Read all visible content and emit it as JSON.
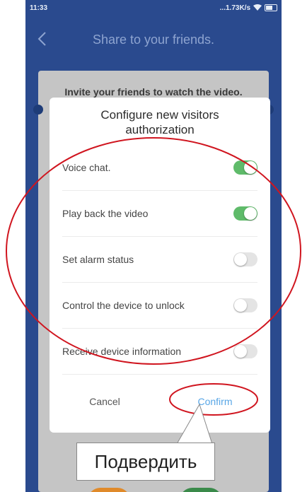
{
  "status_bar": {
    "time": "11:33",
    "speed": "...1.73K/s",
    "wifi_icon": "wifi-icon",
    "battery_icon": "battery-icon"
  },
  "header": {
    "title": "Share to your friends.",
    "back_icon": "chevron-left-icon"
  },
  "background": {
    "card_title": "Invite your friends to watch the video."
  },
  "modal": {
    "title_line1": "Configure new visitors",
    "title_line2": "authorization",
    "permissions": [
      {
        "label": "Voice chat.",
        "enabled": true
      },
      {
        "label": "Play back the video",
        "enabled": true
      },
      {
        "label": "Set alarm status",
        "enabled": false
      },
      {
        "label": "Control the device to unlock",
        "enabled": false
      },
      {
        "label": "Receive device information",
        "enabled": false
      }
    ],
    "cancel_label": "Cancel",
    "confirm_label": "Confirm"
  },
  "annotation": {
    "callout_text": "Подвердить",
    "highlight_color": "#d0151f"
  },
  "colors": {
    "app_bg": "#2a4a8e",
    "toggle_on": "#5fbb6a",
    "confirm": "#58a6e6"
  }
}
